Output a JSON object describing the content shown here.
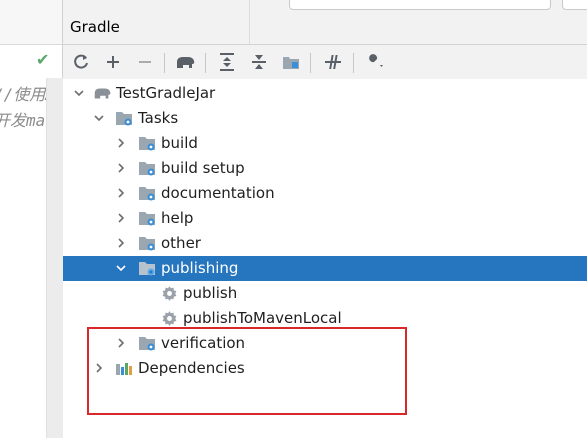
{
  "editor": {
    "code_lines": [
      "//使用…",
      "开发mav…"
    ]
  },
  "panel": {
    "title": "Gradle"
  },
  "toolbar": {
    "buttons": [
      "refresh-icon",
      "add-icon",
      "remove-icon",
      "elephant-icon",
      "expand-all-icon",
      "collapse-all-icon",
      "group-modules-icon",
      "toggle-offline-icon",
      "settings-wrench-icon"
    ]
  },
  "tree": {
    "root": "TestGradleJar",
    "tasks": "Tasks",
    "groups": [
      "build",
      "build setup",
      "documentation",
      "help",
      "other",
      "publishing",
      "verification"
    ],
    "publishing_children": [
      "publish",
      "publishToMavenLocal"
    ],
    "dependencies": "Dependencies",
    "selected": "publishing"
  },
  "colors": {
    "selection": "#2675bf",
    "highlight_border": "#d9282c",
    "folder": "#9aa7b0",
    "gear": "#3c8fd6"
  }
}
